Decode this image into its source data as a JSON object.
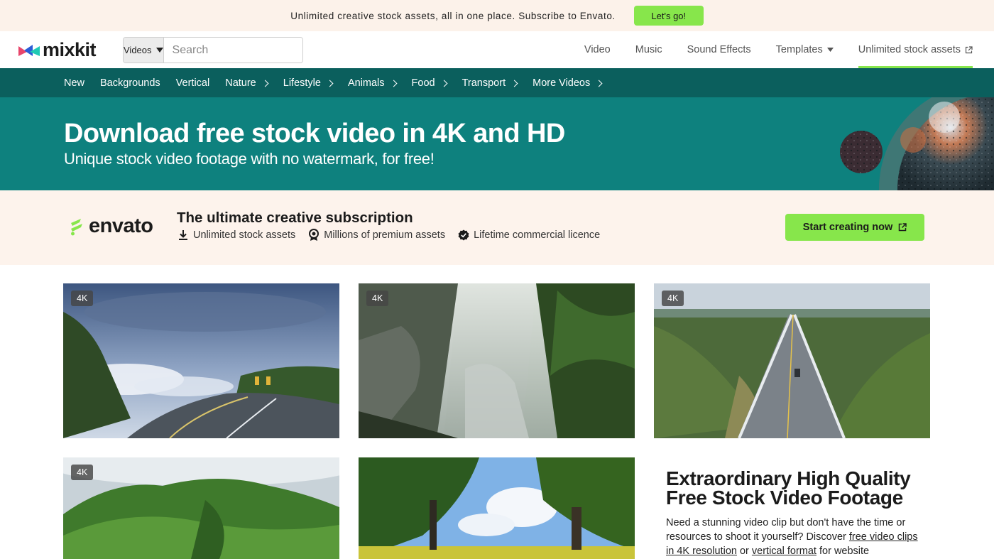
{
  "promo": {
    "text": "Unlimited creative stock assets, all in one place. Subscribe to Envato.",
    "button": "Let's go!"
  },
  "header": {
    "logo": "mixkit",
    "search": {
      "category": "Videos",
      "placeholder": "Search"
    },
    "nav": [
      {
        "label": "Video"
      },
      {
        "label": "Music"
      },
      {
        "label": "Sound Effects"
      },
      {
        "label": "Templates"
      },
      {
        "label": "Unlimited stock assets"
      }
    ]
  },
  "categories": [
    "New",
    "Backgrounds",
    "Vertical",
    "Nature",
    "Lifestyle",
    "Animals",
    "Food",
    "Transport",
    "More Videos"
  ],
  "hero": {
    "title": "Download free stock video in 4K and HD",
    "subtitle": "Unique stock video footage with no watermark, for free!"
  },
  "envato": {
    "logo": "envato",
    "title": "The ultimate creative subscription",
    "features": [
      "Unlimited stock assets",
      "Millions of premium assets",
      "Lifetime commercial licence"
    ],
    "button": "Start creating now"
  },
  "videos": [
    {
      "badge": "4K"
    },
    {
      "badge": "4K"
    },
    {
      "badge": "4K"
    },
    {
      "badge": "4K"
    },
    {
      "badge": ""
    }
  ],
  "info": {
    "title_line1": "Extraordinary High Quality",
    "title_line2": "Free Stock Video Footage",
    "body_start": "Need a stunning video clip but don't have the time or resources to shoot it yourself? Discover ",
    "link1": "free video clips in 4K resolution",
    "body_mid": " or ",
    "link2": "vertical format",
    "body_end": " for website"
  },
  "colors": {
    "accent": "#87e64b",
    "teal_dark": "#0b5f5d",
    "teal": "#0e817e",
    "cream": "#fdf3ec"
  }
}
